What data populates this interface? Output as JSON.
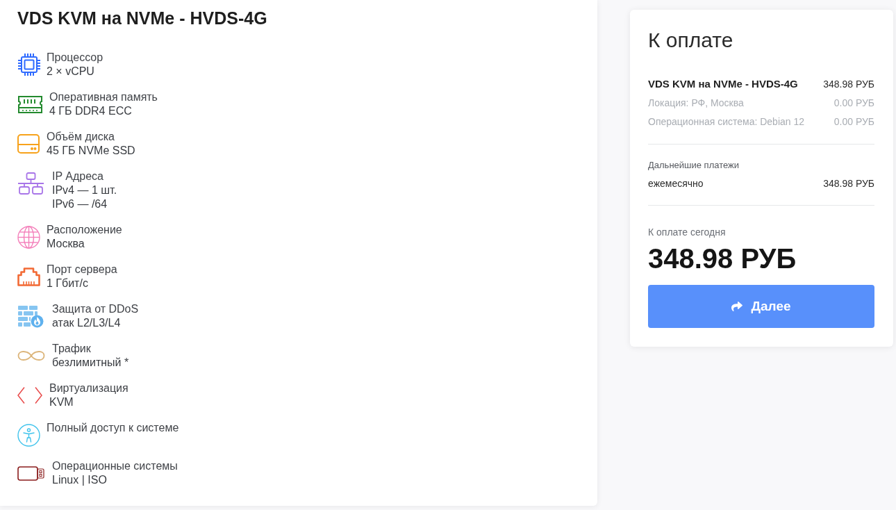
{
  "product": {
    "title": "VDS KVM на NVMe - HVDS-4G"
  },
  "features": [
    {
      "kind": "cpu",
      "label": "Процессор",
      "values": [
        "2 × vCPU"
      ]
    },
    {
      "kind": "ram",
      "label": "Оперативная память",
      "values": [
        "4 ГБ DDR4 ECC"
      ]
    },
    {
      "kind": "disk",
      "label": "Объём диска",
      "values": [
        "45 ГБ NVMe SSD"
      ]
    },
    {
      "kind": "network",
      "label": "IP Адреса",
      "values": [
        "IPv4 — 1 шт.",
        "IPv6 — /64"
      ]
    },
    {
      "kind": "location",
      "label": "Расположение",
      "values": [
        "Москва"
      ]
    },
    {
      "kind": "port",
      "label": "Порт сервера",
      "values": [
        "1 Гбит/с"
      ]
    },
    {
      "kind": "ddos",
      "label": "Защита от DDoS",
      "values": [
        "атак L2/L3/L4"
      ]
    },
    {
      "kind": "traffic",
      "label": "Трафик",
      "values": [
        "безлимитный *"
      ]
    },
    {
      "kind": "virtualization",
      "label": "Виртуализация",
      "values": [
        "KVM"
      ]
    },
    {
      "kind": "access",
      "label": "Полный доступ к системе"
    },
    {
      "kind": "os",
      "label": "Операционные системы",
      "values": [
        "Linux | ISO"
      ]
    }
  ],
  "summary": {
    "title": "К оплате",
    "lines": [
      {
        "kind": "main",
        "label": "VDS KVM на NVMe - HVDS-4G",
        "price": "348.98 РУБ"
      },
      {
        "kind": "option",
        "label": "Локация: РФ, Москва",
        "price": "0.00 РУБ"
      },
      {
        "kind": "option",
        "label": "Операционная система: Debian 12",
        "price": "0.00 РУБ"
      }
    ],
    "recurring": {
      "heading": "Дальнейшие платежи",
      "period": "ежемесячно",
      "price": "348.98 РУБ"
    },
    "due": {
      "label": "К оплате сегодня",
      "total": "348.98 РУБ"
    },
    "button": {
      "label": "Далее"
    }
  }
}
